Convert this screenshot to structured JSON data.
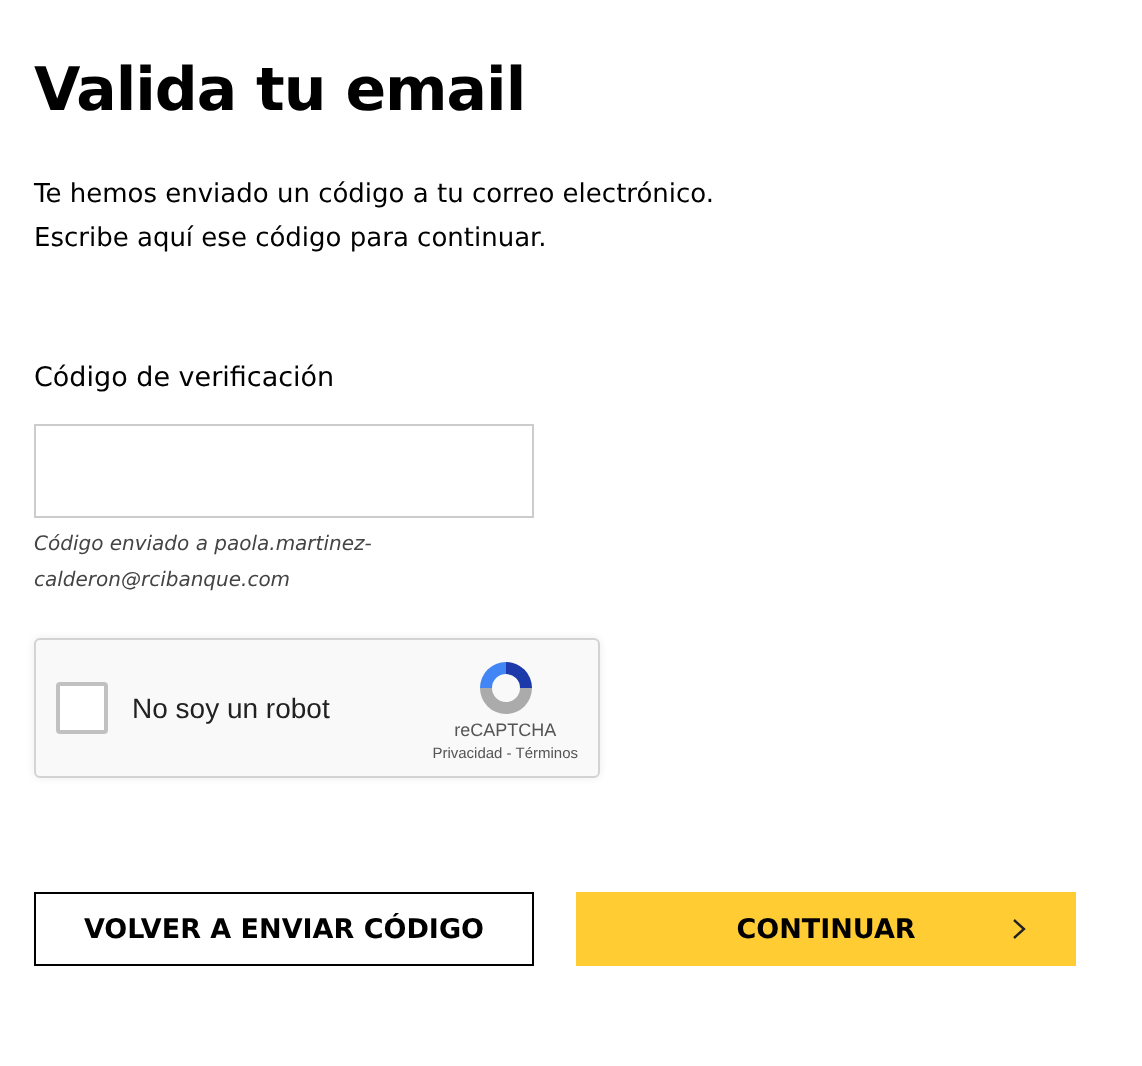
{
  "title": "Valida tu email",
  "intro": [
    "Te hemos enviado un código a tu correo electrónico.",
    "Escribe aquí ese código para continuar."
  ],
  "code_field": {
    "label": "Código de verificación",
    "hint": "Código enviado a paola.martinez-calderon@rcibanque.com"
  },
  "captcha": {
    "checked": false,
    "label": "No soy un robot",
    "brand": "reCAPTCHA",
    "links": "Privacidad - Términos"
  },
  "buttons": [
    {
      "kind": "secondary",
      "label": "VOLVER A ENVIAR CÓDIGO"
    },
    {
      "kind": "primary",
      "label": "CONTINUAR"
    }
  ]
}
